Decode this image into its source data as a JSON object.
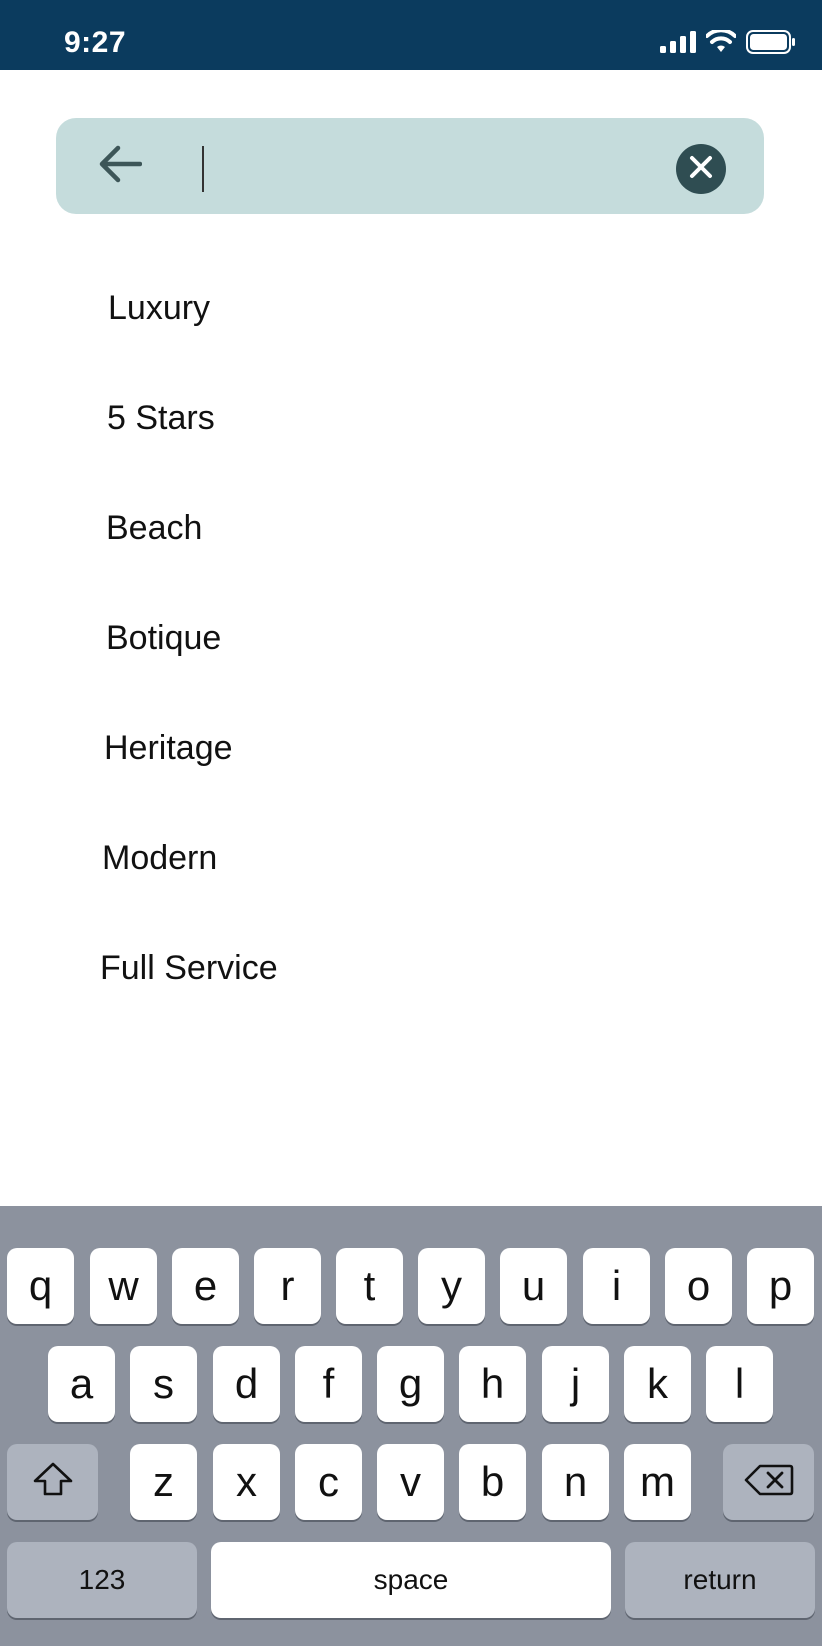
{
  "status": {
    "time": "9:27",
    "icons": [
      "signal-icon",
      "wifi-icon",
      "battery-icon"
    ]
  },
  "search": {
    "value": "",
    "placeholder": "",
    "back_icon": "arrow-left-icon",
    "clear_icon": "clear-circle-icon"
  },
  "suggestions": [
    "Luxury",
    "5 Stars",
    "Beach",
    "Botique",
    "Heritage",
    "Modern",
    "Full Service"
  ],
  "keyboard": {
    "row1": [
      "q",
      "w",
      "e",
      "r",
      "t",
      "y",
      "u",
      "i",
      "o",
      "p"
    ],
    "row2": [
      "a",
      "s",
      "d",
      "f",
      "g",
      "h",
      "j",
      "k",
      "l"
    ],
    "row3": [
      "z",
      "x",
      "c",
      "v",
      "b",
      "n",
      "m"
    ],
    "shift_icon": "shift-icon",
    "delete_icon": "backspace-icon",
    "numbers_label": "123",
    "space_label": "space",
    "return_label": "return"
  },
  "colors": {
    "status_bar": "#0b3b5e",
    "search_bg": "#c5dcdc",
    "clear_button": "#2f4d52",
    "keyboard_bg": "#8c929e",
    "fn_key": "#adb3be"
  }
}
